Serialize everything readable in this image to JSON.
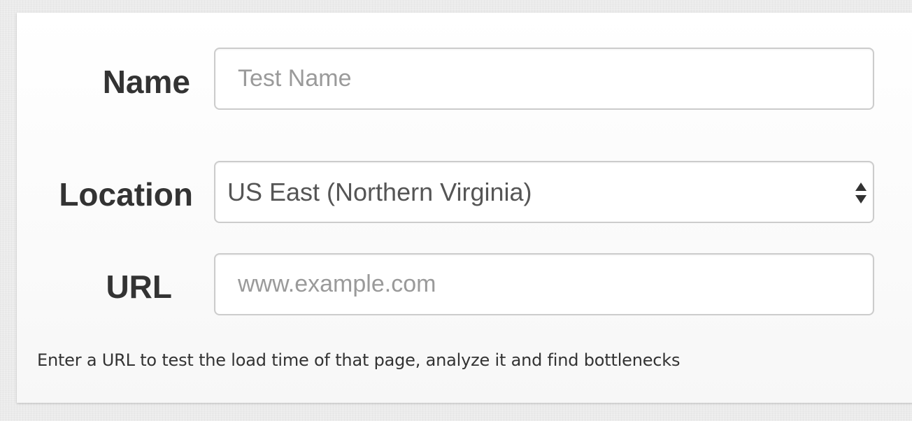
{
  "form": {
    "name": {
      "label": "Name",
      "placeholder": "Test Name",
      "value": ""
    },
    "location": {
      "label": "Location",
      "selected": "US East (Northern Virginia)"
    },
    "url": {
      "label": "URL",
      "placeholder": "www.example.com",
      "value": ""
    },
    "help_text": "Enter a URL to test the load time of that page, analyze it and find bottlenecks"
  },
  "icons": {
    "select_arrows": "up-down-arrows-icon"
  },
  "colors": {
    "label_text": "#333333",
    "input_border": "#cccccc",
    "placeholder": "#9a9a9a",
    "value_text": "#555555"
  }
}
